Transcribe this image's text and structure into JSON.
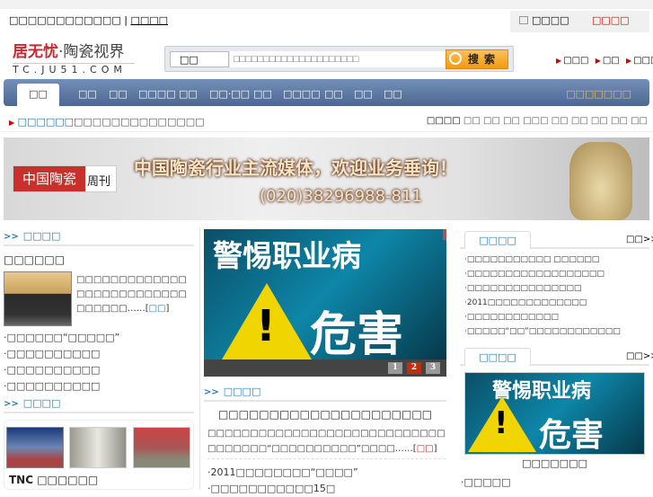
{
  "topbar": {
    "welcome": "□□□□□□□□□□□□",
    "sep": "|",
    "home_link": "□□□□",
    "fav": "□□□□",
    "login": "□□□□"
  },
  "logo": {
    "brand": "居无忧",
    "sub": "·陶瓷视界",
    "domain": "TC.JU51.COM"
  },
  "search": {
    "category": "□□",
    "placeholder": "□□□□□□□□□□□□□□□□□□□□□",
    "button": "搜索"
  },
  "header_links": [
    "□□□",
    "□□",
    "□□□□"
  ],
  "nav": {
    "items": [
      "□□",
      "□□",
      "□□",
      "□□□□",
      "□□",
      "□□·□□",
      "□□",
      "□□□□",
      "□□",
      "□□",
      "□□"
    ],
    "right": "□□□□□□□"
  },
  "ticker": {
    "label": "□□□□□",
    "text": "□□□□□□□□□□□□□□□"
  },
  "hot_search": {
    "label": "□□□□",
    "items": [
      "□□",
      "□□",
      "□□",
      "□□□",
      "□□",
      "□□",
      "□□",
      "□□",
      "□□"
    ]
  },
  "banner": {
    "logo_red": "中国陶瓷",
    "logo_black": "周刊",
    "slogan": "中国陶瓷行业主流媒体，欢迎业务垂询！",
    "phone": "(020)38296988-811"
  },
  "left": {
    "heading1": "□□□□",
    "feature_title": "□□□□□□",
    "feature_summary": "□□□□□□□□□□□□□□□□□□□□□□□□□□□□□□□□……",
    "feature_more": "□□",
    "list": [
      "·□□□□□□“□□□□□”",
      "·□□□□□□□□□□",
      "·□□□□□□□□□□",
      "·□□□□□□□□□□"
    ],
    "heading2": "□□□□",
    "photo_caption": "TNC □□□□□□"
  },
  "middle": {
    "slide_line1": "警惕职业病",
    "slide_line2": "危害",
    "pages": [
      "1",
      "2",
      "3"
    ],
    "active_page": "2",
    "heading": "□□□□",
    "title": "□□□□□□□□□□□□□□□□□□□□□",
    "summary": "□□□□□□□□□□□□□□□□□□□□□□□□□□□□□□□□□□□“□□□□□□□□□□”□□□□……",
    "summary_more": "□□",
    "list": [
      "·2011□□□□□□□□“□□□□”",
      "·□□□□□□□□□□□15□"
    ]
  },
  "right": {
    "tab1": "□□□□",
    "more1": "□□>>",
    "list": [
      "·□□□□□□□□□□□ □□□□□□",
      "·□□□□□□□□□□□□□□□□□□",
      "·□□□□□□□□□□□□□□□",
      "·2011□□□□□□□□□□□□□",
      "·□□□□□□□□□□□□",
      "·□□□□□“□□”□□□□□□□□□□□□"
    ],
    "tab2": "□□□□",
    "more2": "□□>>",
    "image_caption": "□□□□□□□",
    "bottom_item": "·□□□□□"
  }
}
